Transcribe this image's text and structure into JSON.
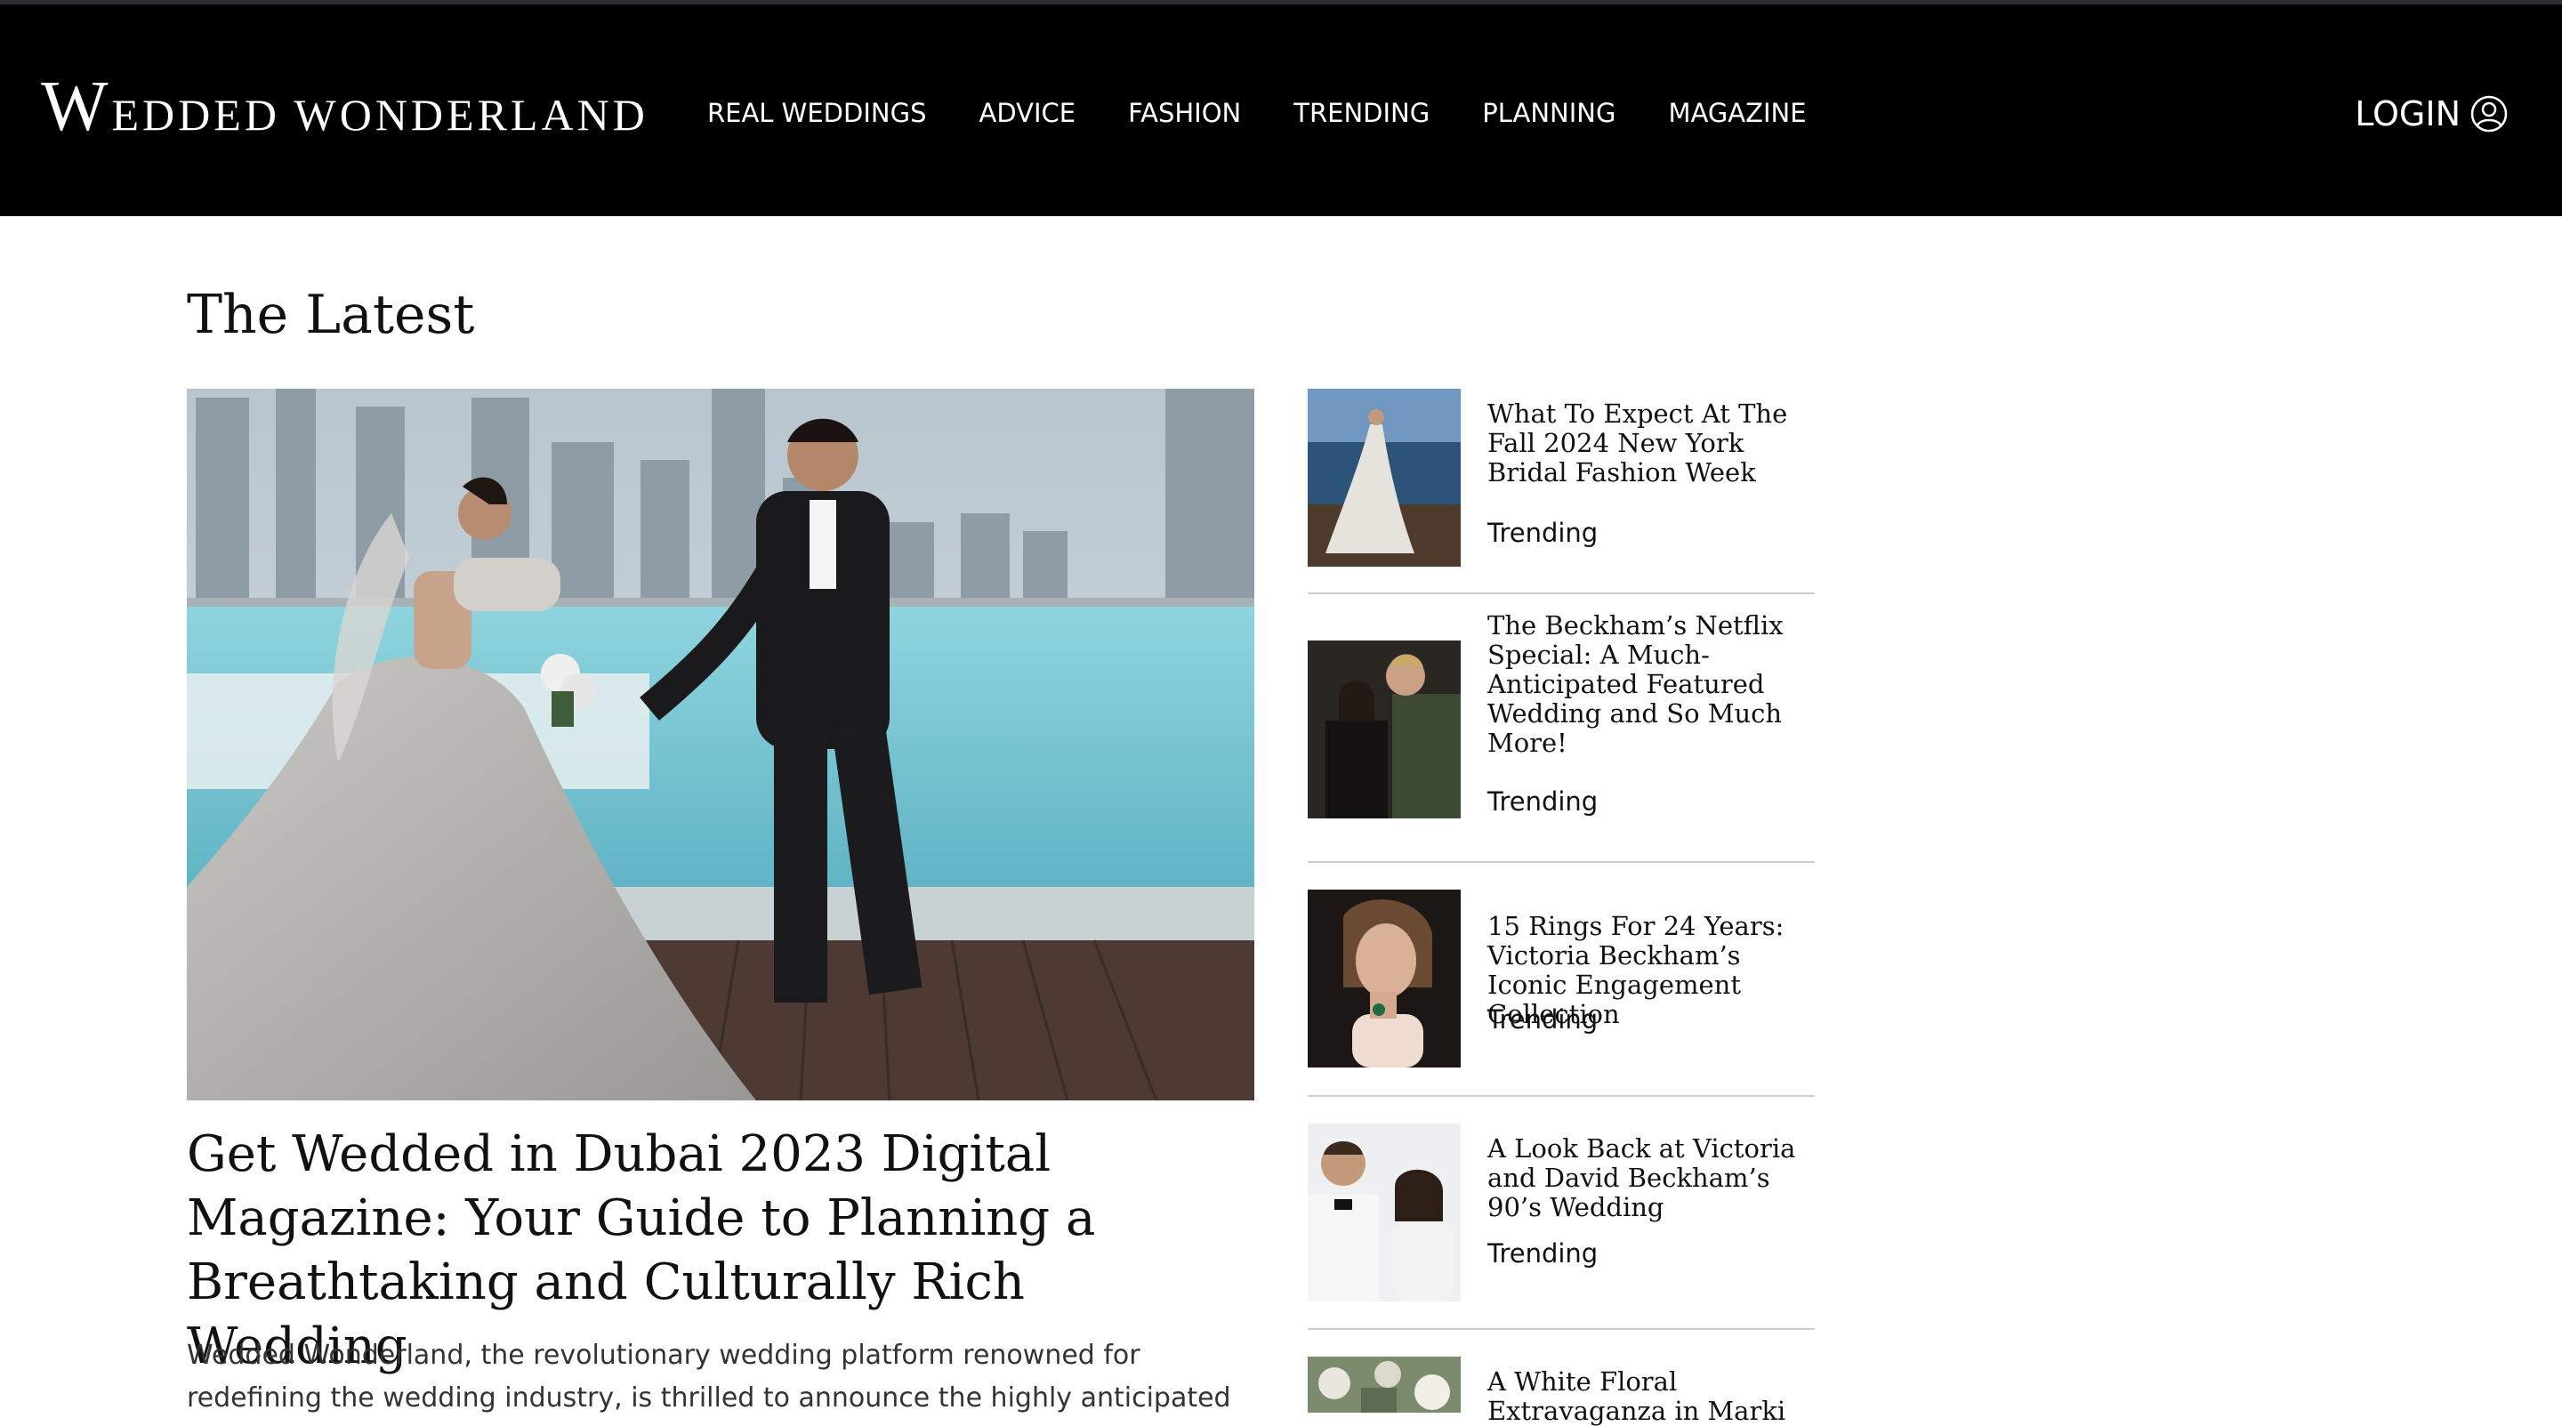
{
  "site": {
    "logo_cap": "W",
    "logo_rest": "EDDED WONDERLAND"
  },
  "nav": {
    "items": [
      "REAL WEDDINGS",
      "ADVICE",
      "FASHION",
      "TRENDING",
      "PLANNING",
      "MAGAZINE"
    ]
  },
  "header": {
    "login_label": "LOGIN",
    "login_icon": "user-circle-icon",
    "background": "#000000"
  },
  "latest": {
    "title": "The Latest",
    "hero": {
      "title": "Get Wedded in Dubai 2023 Digital Magazine: Your Guide to Planning a Breathtaking and Culturally Rich Wedding",
      "excerpt": "Wedded Wonderland, the revolutionary wedding platform renowned for redefining the wedding industry, is thrilled to announce the highly anticipated",
      "image": "couple-rooftop-pool-dubai-photo"
    },
    "side_items": [
      {
        "title": "What To Expect At The Fall 2024 New York Bridal Fashion Week",
        "category": "Trending",
        "image": "bride-gown-seaside-photo"
      },
      {
        "title": "The Beckham’s Netflix Special: A Much-Anticipated Featured Wedding and So Much More!",
        "category": "Trending",
        "image": "beckham-couple-photo"
      },
      {
        "title": "15 Rings For 24 Years: Victoria Beckham’s Iconic Engagement Collection",
        "category": "Trending",
        "image": "victoria-portrait-photo"
      },
      {
        "title": "A Look Back at Victoria and David Beckham’s 90’s Wedding",
        "category": "Trending",
        "image": "beckham-wedding-photo"
      },
      {
        "title": "A White Floral Extravaganza in Marki",
        "category": "",
        "image": "floral-photo"
      }
    ]
  }
}
